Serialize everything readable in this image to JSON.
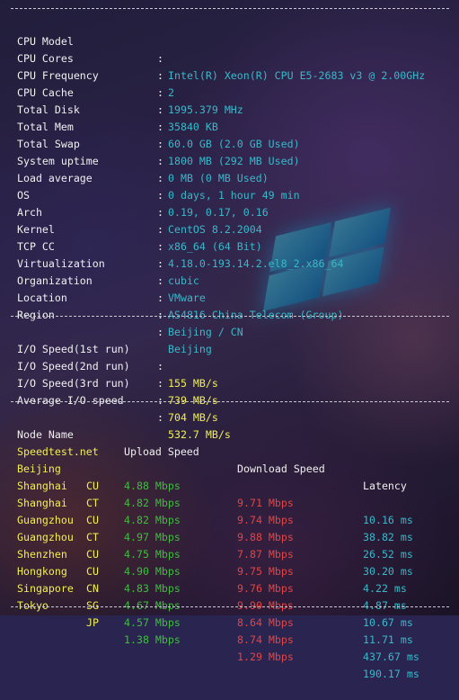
{
  "colors": {
    "label": "#f0f0f0",
    "info_value": "#37b9c9",
    "io_value": "#f1ef4e",
    "upload": "#3fbd3f",
    "download": "#e04646",
    "latency": "#37b9c9"
  },
  "system": {
    "cpu_model": {
      "label": "CPU Model",
      "value": "Intel(R) Xeon(R) CPU E5-2683 v3 @ 2.00GHz"
    },
    "cpu_cores": {
      "label": "CPU Cores",
      "value": "2"
    },
    "cpu_frequency": {
      "label": "CPU Frequency",
      "value": "1995.379 MHz"
    },
    "cpu_cache": {
      "label": "CPU Cache",
      "value": "35840 KB"
    },
    "total_disk": {
      "label": "Total Disk",
      "value": "60.0 GB (2.0 GB Used)"
    },
    "total_mem": {
      "label": "Total Mem",
      "value": "1800 MB (292 MB Used)"
    },
    "total_swap": {
      "label": "Total Swap",
      "value": "0 MB (0 MB Used)"
    },
    "system_uptime": {
      "label": "System uptime",
      "value": "0 days, 1 hour 49 min"
    },
    "load_average": {
      "label": "Load average",
      "value": "0.19, 0.17, 0.16"
    },
    "os": {
      "label": "OS",
      "value": "CentOS 8.2.2004"
    },
    "arch": {
      "label": "Arch",
      "value": "x86_64 (64 Bit)"
    },
    "kernel": {
      "label": "Kernel",
      "value": "4.18.0-193.14.2.el8_2.x86_64"
    },
    "tcp_cc": {
      "label": "TCP CC",
      "value": "cubic"
    },
    "virtualization": {
      "label": "Virtualization",
      "value": "VMware"
    },
    "organization": {
      "label": "Organization",
      "value": "AS4816 China Telecom (Group)"
    },
    "location": {
      "label": "Location",
      "value": "Beijing / CN"
    },
    "region": {
      "label": "Region",
      "value": "Beijing"
    }
  },
  "io": {
    "run1": {
      "label": "I/O Speed(1st run)",
      "value": "155 MB/s"
    },
    "run2": {
      "label": "I/O Speed(2nd run)",
      "value": "739 MB/s"
    },
    "run3": {
      "label": "I/O Speed(3rd run)",
      "value": "704 MB/s"
    },
    "average": {
      "label": "Average I/O speed",
      "value": "532.7 MB/s"
    }
  },
  "speedtest": {
    "headers": {
      "node": "Node Name",
      "upload": "Upload Speed",
      "download": "Download Speed",
      "latency": "Latency"
    },
    "rows": [
      {
        "name": "Speedtest.net",
        "isp": "",
        "upload": "4.88 Mbps",
        "download": "9.71 Mbps",
        "latency": "10.16 ms"
      },
      {
        "name": "Beijing",
        "isp": "CU",
        "upload": "4.82 Mbps",
        "download": "9.74 Mbps",
        "latency": "38.82 ms"
      },
      {
        "name": "Shanghai",
        "isp": "CT",
        "upload": "4.82 Mbps",
        "download": "9.88 Mbps",
        "latency": "26.52 ms"
      },
      {
        "name": "Shanghai",
        "isp": "CU",
        "upload": "4.97 Mbps",
        "download": "7.87 Mbps",
        "latency": "30.20 ms"
      },
      {
        "name": "Guangzhou",
        "isp": "CT",
        "upload": "4.75 Mbps",
        "download": "9.75 Mbps",
        "latency": "4.22 ms"
      },
      {
        "name": "Guangzhou",
        "isp": "CU",
        "upload": "4.90 Mbps",
        "download": "9.76 Mbps",
        "latency": "4.87 ms"
      },
      {
        "name": "Shenzhen",
        "isp": "CU",
        "upload": "4.83 Mbps",
        "download": "9.90 Mbps",
        "latency": "10.67 ms"
      },
      {
        "name": "Hongkong",
        "isp": "CN",
        "upload": "4.67 Mbps",
        "download": "8.64 Mbps",
        "latency": "11.71 ms"
      },
      {
        "name": "Singapore",
        "isp": "SG",
        "upload": "4.57 Mbps",
        "download": "8.74 Mbps",
        "latency": "437.67 ms"
      },
      {
        "name": "Tokyo",
        "isp": "JP",
        "upload": "1.38 Mbps",
        "download": "1.29 Mbps",
        "latency": "190.17 ms"
      }
    ]
  }
}
